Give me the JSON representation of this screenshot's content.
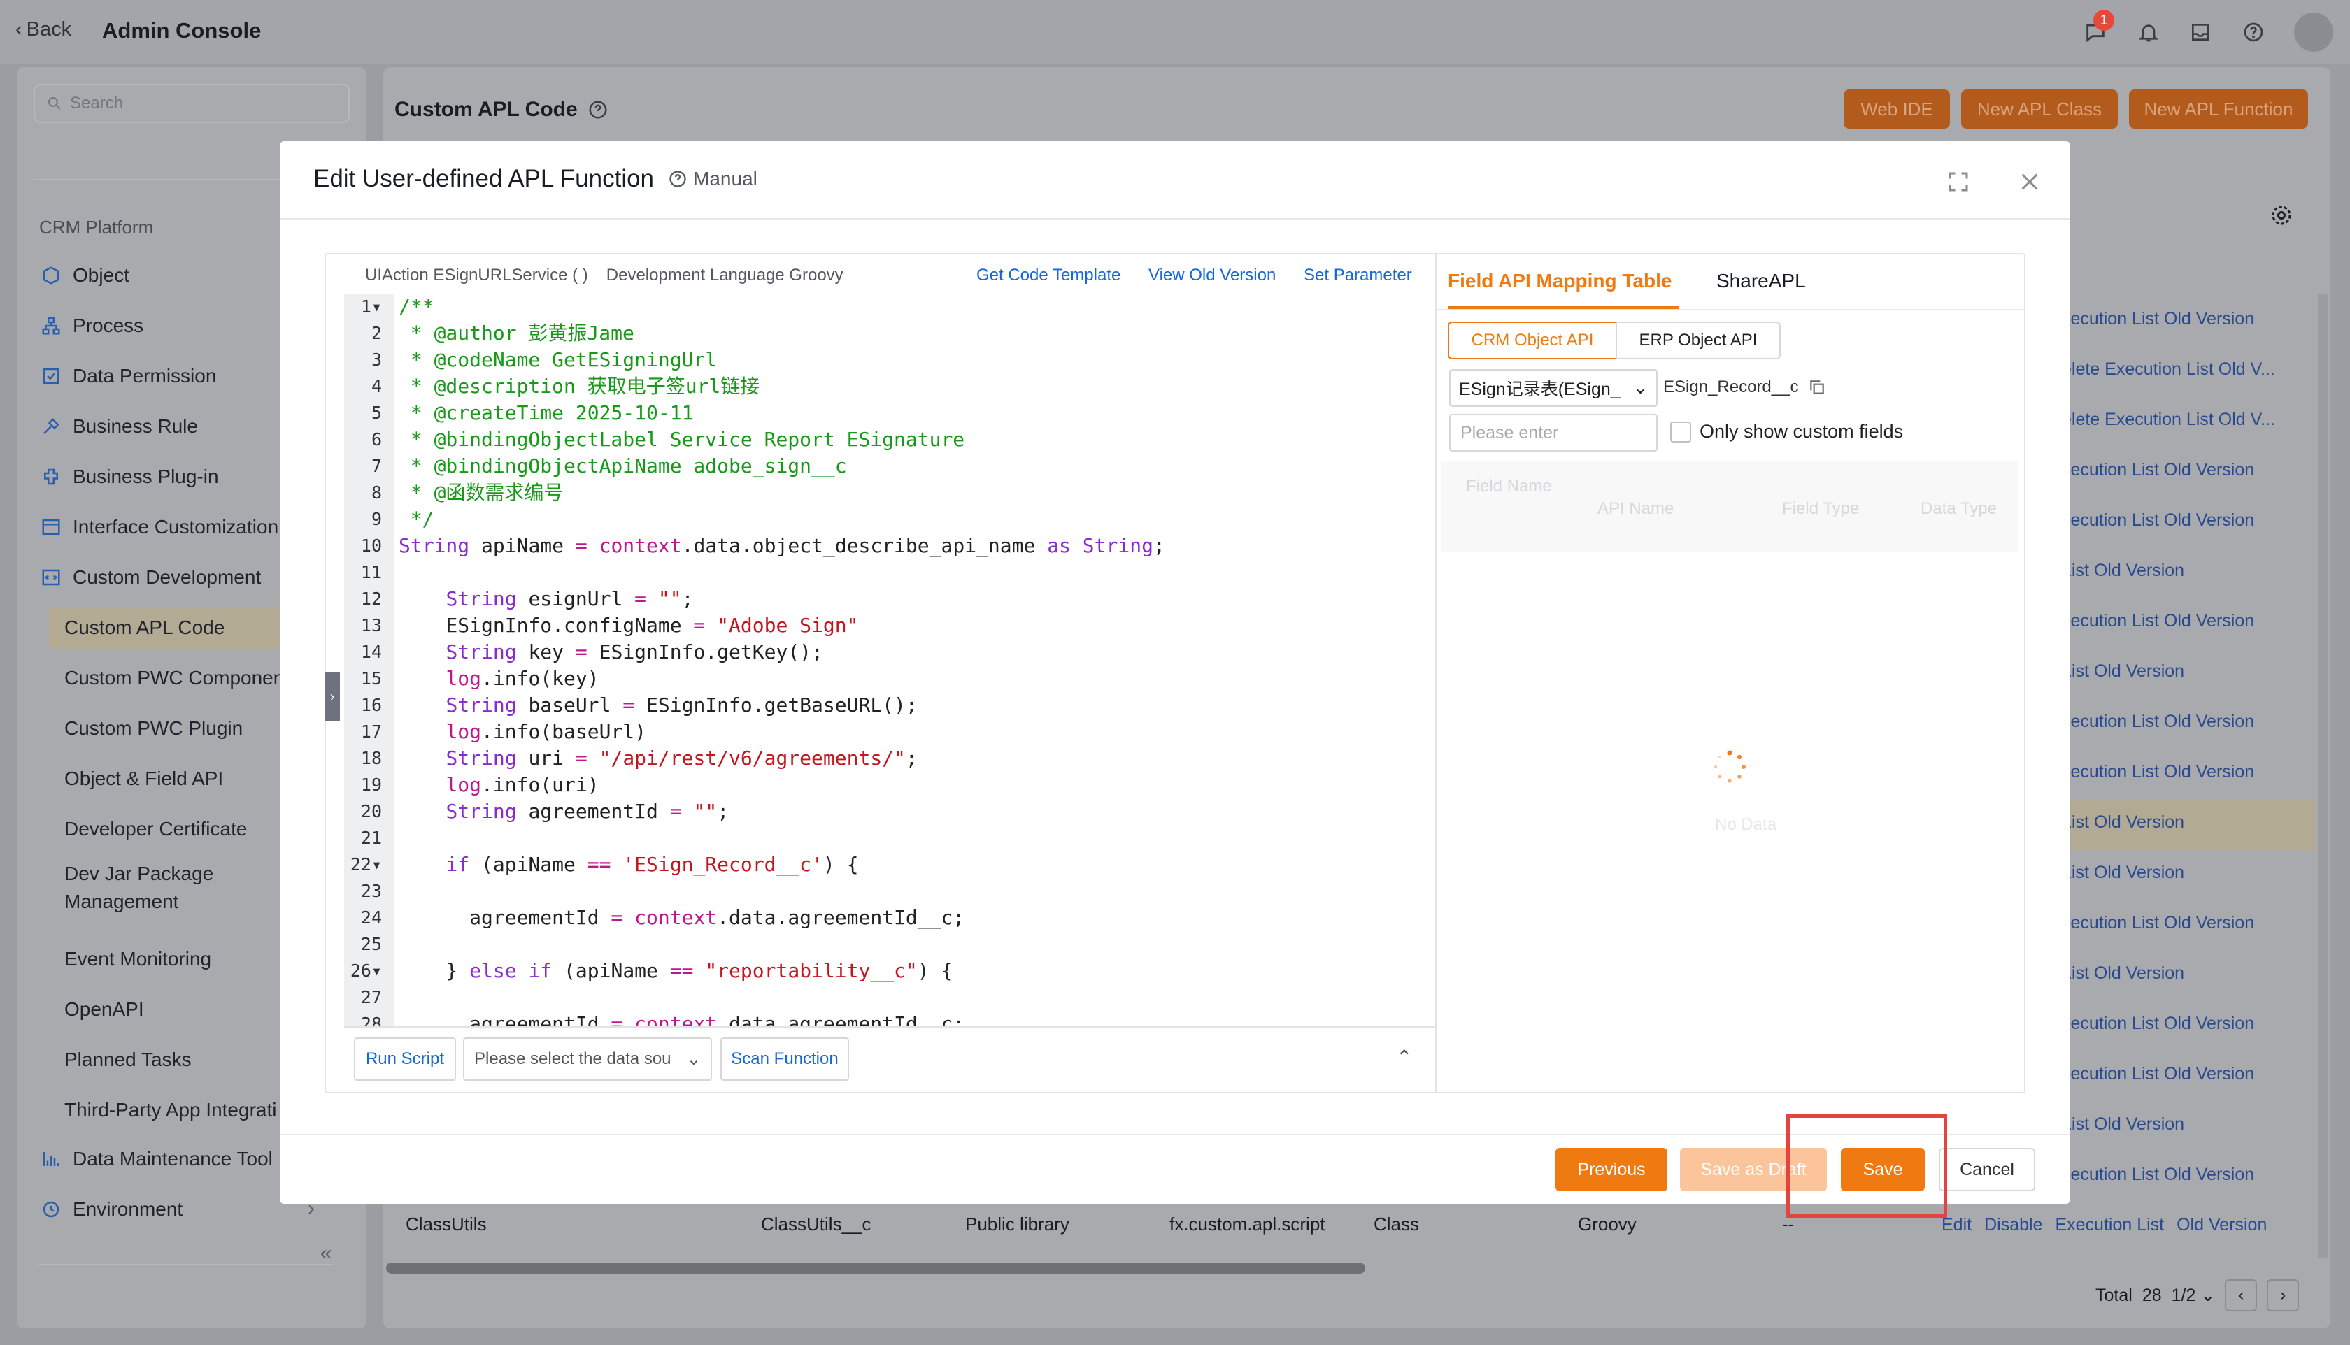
{
  "header": {
    "back_label": "Back",
    "title": "Admin Console",
    "notif_count": "1"
  },
  "sidebar": {
    "search_placeholder": "Search",
    "section": "CRM Platform",
    "items": [
      {
        "label": "Object",
        "icon": "object-icon"
      },
      {
        "label": "Process",
        "icon": "process-icon"
      },
      {
        "label": "Data Permission",
        "icon": "data-permission-icon"
      },
      {
        "label": "Business Rule",
        "icon": "business-rule-icon"
      },
      {
        "label": "Business Plug-in",
        "icon": "plugin-icon"
      },
      {
        "label": "Interface Customization",
        "icon": "interface-icon"
      },
      {
        "label": "Custom Development",
        "icon": "code-icon"
      }
    ],
    "subitems": [
      "Custom APL Code",
      "Custom PWC Componen",
      "Custom PWC Plugin",
      "Object & Field API",
      "Developer Certificate",
      "Dev Jar Package",
      "Management",
      "Event Monitoring",
      "OpenAPI",
      "Planned Tasks",
      "Third-Party App Integrati"
    ],
    "bottom_items": [
      {
        "label": "Data Maintenance Tool",
        "icon": "chart-icon"
      },
      {
        "label": "Environment",
        "icon": "environment-icon"
      }
    ],
    "collapse": "«"
  },
  "main": {
    "title": "Custom APL Code",
    "buttons": [
      "Web IDE",
      "New APL Class",
      "New APL Function"
    ],
    "row_actions": [
      "xecution List  Old Version",
      "elete  Execution List  Old V...",
      "elete  Execution List  Old V...",
      "xecution List  Old Version",
      "xecution List  Old Version",
      "List  Old Version",
      "xecution List  Old Version",
      "List  Old Version",
      "xecution List  Old Version",
      "xecution List  Old Version",
      "List  Old Version",
      "List  Old Version",
      "xecution List  Old Version",
      "List  Old Version",
      "xecution List  Old Version",
      "xecution List  Old Version",
      "List  Old Version",
      "xecution List  Old Version"
    ],
    "bottom_row": {
      "name": "ClassUtils",
      "api": "ClassUtils__c",
      "type": "Public library",
      "namespace": "fx.custom.apl.script",
      "kind": "Class",
      "lang": "Groovy",
      "dash": "--",
      "actions": [
        "Edit",
        "Disable",
        "Execution List",
        "Old Version"
      ]
    },
    "pager": {
      "total_label": "Total",
      "total": "28",
      "page": "1/2"
    }
  },
  "modal": {
    "title": "Edit User-defined APL Function",
    "manual": "Manual",
    "code_header": {
      "action": "UIAction ESignURLService ( )",
      "lang": "Development Language Groovy"
    },
    "links": [
      "Get Code Template",
      "View Old Version",
      "Set Parameter"
    ],
    "code_lines": [
      "/**",
      " * @author 彭黄振Jame",
      " * @codeName GetESigningUrl",
      " * @description 获取电子签url链接",
      " * @createTime 2025-10-11",
      " * @bindingObjectLabel Service Report ESignature",
      " * @bindingObjectApiName adobe_sign__c",
      " * @函数需求编号",
      " */",
      "String apiName = context.data.object_describe_api_name as String;",
      "",
      "    String esignUrl = \"\";",
      "    ESignInfo.configName = \"Adobe Sign\"",
      "    String key = ESignInfo.getKey();",
      "    log.info(key)",
      "    String baseUrl = ESignInfo.getBaseURL();",
      "    log.info(baseUrl)",
      "    String uri = \"/api/rest/v6/agreements/\";",
      "    log.info(uri)",
      "    String agreementId = \"\";",
      "",
      "    if (apiName == 'ESign_Record__c') {",
      "",
      "      agreementId = context.data.agreementId__c;",
      "",
      "    } else if (apiName == \"reportability__c\") {",
      "",
      "      agreementId = context.data.agreementId__c;"
    ],
    "footer": {
      "run": "Run Script",
      "select_placeholder": "Please select the data sou",
      "scan": "Scan Function"
    },
    "right": {
      "tabs": [
        "Field API Mapping Table",
        "ShareAPL"
      ],
      "segments": [
        "CRM Object API",
        "ERP Object API"
      ],
      "object": "ESign记录表(ESign_",
      "object_api": "ESign_Record__c",
      "input_placeholder": "Please enter",
      "checkbox": "Only show custom fields",
      "columns": [
        "Field Name",
        "API Name",
        "Field Type",
        "Data Type"
      ],
      "empty": "No Data"
    },
    "buttons": {
      "previous": "Previous",
      "draft": "Save as Draft",
      "save": "Save",
      "cancel": "Cancel"
    },
    "colors": {
      "accent": "#f07a12",
      "link": "#1668d7",
      "highlight": "#e5443c"
    }
  }
}
